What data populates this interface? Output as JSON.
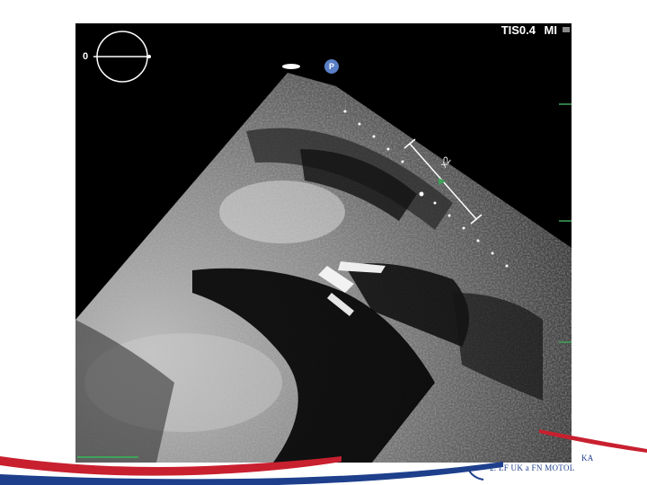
{
  "ultrasound": {
    "tis_label": "TIS0.4",
    "mi_label": "MI",
    "angle_value": "0",
    "probe_marker": "P",
    "zoom_label": "x2"
  },
  "footer": {
    "institution_line1": "KA",
    "institution_line2": "2. LF UK a FN MOTOL",
    "colors": {
      "red": "#c8202f",
      "blue": "#1e3f8c"
    }
  }
}
